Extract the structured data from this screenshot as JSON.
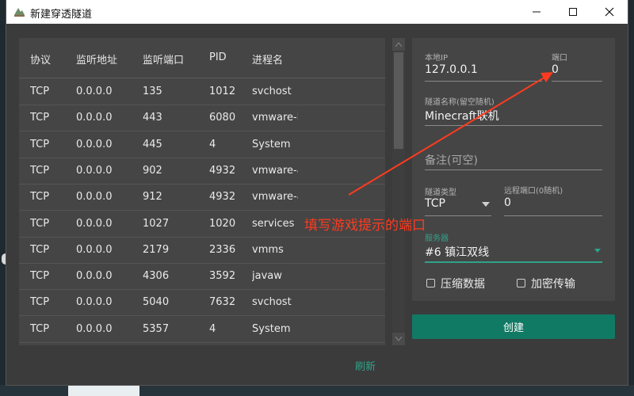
{
  "window": {
    "title": "新建穿透隧道"
  },
  "table": {
    "headers": [
      "协议",
      "监听地址",
      "监听端口",
      "PID",
      "进程名"
    ],
    "rows": [
      [
        "TCP",
        "0.0.0.0",
        "135",
        "1012",
        "svchost"
      ],
      [
        "TCP",
        "0.0.0.0",
        "443",
        "6080",
        "vmware-h"
      ],
      [
        "TCP",
        "0.0.0.0",
        "445",
        "4",
        "System"
      ],
      [
        "TCP",
        "0.0.0.0",
        "902",
        "4932",
        "vmware-a"
      ],
      [
        "TCP",
        "0.0.0.0",
        "912",
        "4932",
        "vmware-a"
      ],
      [
        "TCP",
        "0.0.0.0",
        "1027",
        "1020",
        "services"
      ],
      [
        "TCP",
        "0.0.0.0",
        "2179",
        "2336",
        "vmms"
      ],
      [
        "TCP",
        "0.0.0.0",
        "4306",
        "3592",
        "javaw"
      ],
      [
        "TCP",
        "0.0.0.0",
        "5040",
        "7632",
        "svchost"
      ],
      [
        "TCP",
        "0.0.0.0",
        "5357",
        "4",
        "System"
      ]
    ]
  },
  "refresh_label": "刷新",
  "form": {
    "local_ip": {
      "label": "本地IP",
      "value": "127.0.0.1"
    },
    "port": {
      "label": "端口",
      "value": "0"
    },
    "tunnel_name": {
      "label": "隧道名称(留空随机)",
      "value": "Minecraft联机"
    },
    "note": {
      "placeholder": "备注(可空)"
    },
    "tunnel_type": {
      "label": "隧道类型",
      "value": "TCP"
    },
    "remote_port": {
      "label": "远程端口(0随机)",
      "value": "0"
    },
    "server": {
      "label": "服务器",
      "value": "#6 镇江双线"
    },
    "compress": {
      "label": "压缩数据",
      "checked": false
    },
    "encrypt": {
      "label": "加密传输",
      "checked": false
    }
  },
  "create_label": "创建",
  "annotation": {
    "text": "填写游戏提示的端口",
    "color": "#ff3b1f"
  },
  "colors": {
    "accent": "#2fa38a",
    "button": "#117a64"
  },
  "icons": [
    "app-icon",
    "minimize-icon",
    "maximize-icon",
    "close-icon",
    "scroll-up-icon",
    "scroll-down-icon",
    "dropdown-arrow-icon",
    "checkbox-icon",
    "arrow-annotation"
  ]
}
